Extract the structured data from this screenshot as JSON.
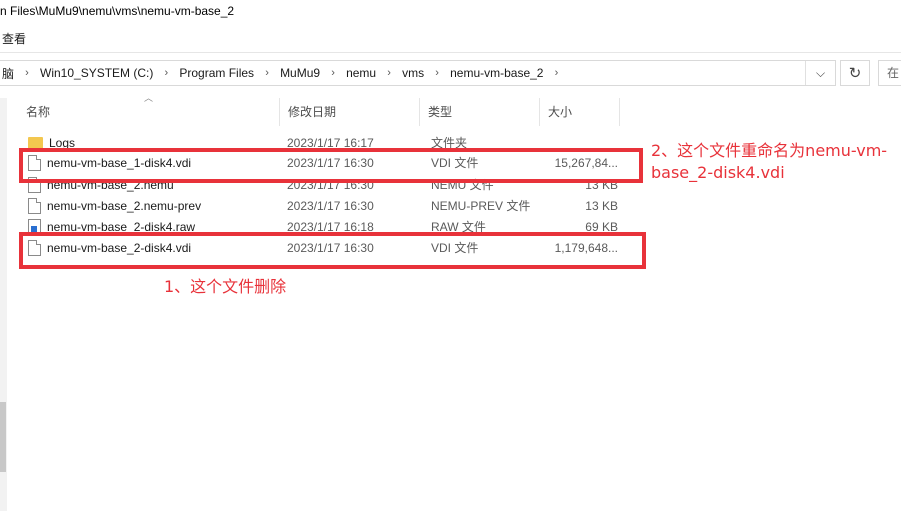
{
  "window": {
    "title": "n Files\\MuMu9\\nemu\\vms\\nemu-vm-base_2"
  },
  "menubar": {
    "view_label": "查看"
  },
  "address": {
    "crumbs": [
      "脑",
      "Win10_SYSTEM (C:)",
      "Program Files",
      "MuMu9",
      "nemu",
      "vms",
      "nemu-vm-base_2"
    ],
    "separator": "›",
    "dropdown_glyph": "⌵",
    "refresh_glyph": "↻",
    "search_placeholder": "在"
  },
  "columns": {
    "name": "名称",
    "date": "修改日期",
    "type": "类型",
    "size": "大小"
  },
  "files": [
    {
      "name": "Logs",
      "date": "2023/1/17 16:17",
      "type": "文件夹",
      "size": "",
      "icon": "folder-icon"
    },
    {
      "name": "nemu-vm-base_1-disk4.vdi",
      "date": "2023/1/17 16:30",
      "type": "VDI 文件",
      "size": "15,267,84...",
      "icon": "file-icon"
    },
    {
      "name": "nemu-vm-base_2.nemu",
      "date": "2023/1/17 16:30",
      "type": "NEMU 文件",
      "size": "13 KB",
      "icon": "file-icon"
    },
    {
      "name": "nemu-vm-base_2.nemu-prev",
      "date": "2023/1/17 16:30",
      "type": "NEMU-PREV 文件",
      "size": "13 KB",
      "icon": "file-icon"
    },
    {
      "name": "nemu-vm-base_2-disk4.raw",
      "date": "2023/1/17 16:18",
      "type": "RAW 文件",
      "size": "69 KB",
      "icon": "raw-file-icon"
    },
    {
      "name": "nemu-vm-base_2-disk4.vdi",
      "date": "2023/1/17 16:30",
      "type": "VDI 文件",
      "size": "1,179,648...",
      "icon": "file-icon"
    }
  ],
  "annotations": {
    "rename_note_line1": "2、这个文件重命名为nemu-vm-",
    "rename_note_line2": "base_2-disk4.vdi",
    "delete_note": "1、这个文件删除",
    "color": "#e8323a"
  }
}
